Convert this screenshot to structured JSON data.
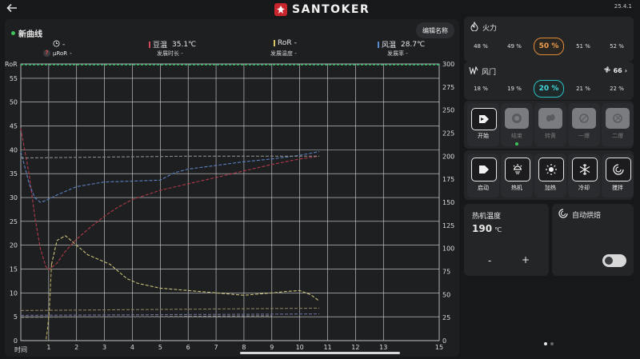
{
  "top_bar": {
    "back_icon": "arrow-left-icon",
    "brand": "SANTOKER",
    "version": "25.4.1"
  },
  "header": {
    "curve_name": "新曲线",
    "rename_button": "编辑名称",
    "time_value": "-",
    "uror_label": "μRoR",
    "uror_value": "-",
    "bean_label": "豆温",
    "bean_value": "35.1℃",
    "bean_sub": "发展时长 -",
    "ror_label": "RoR",
    "ror_value": "-",
    "ror_sub": "发展温度 -",
    "air_label": "风温",
    "air_value": "28.7℃",
    "air_sub": "发展率 -"
  },
  "colors": {
    "accent_orange": "#e08a3c",
    "accent_teal": "#2bc0c4",
    "bean_curve": "#b03a48",
    "air_curve": "#5a7fc0",
    "ror_curve": "#c9c07a",
    "status_green": "#3fc35a"
  },
  "chart_data": {
    "type": "line",
    "xlabel": "时间",
    "ylabel_left": "RoR",
    "x_ticks": [
      "1",
      "2",
      "3",
      "4",
      "5",
      "6",
      "7",
      "8",
      "9",
      "10",
      "11",
      "12",
      "13",
      "15"
    ],
    "y_left_ticks": [
      "0",
      "5",
      "10",
      "15",
      "20",
      "25",
      "30",
      "35",
      "40",
      "45",
      "50",
      "55"
    ],
    "y_right_ticks": [
      "0",
      "25",
      "50",
      "75",
      "100",
      "125",
      "150",
      "175",
      "200",
      "225",
      "250",
      "275",
      "300"
    ],
    "xlim": [
      0,
      15
    ],
    "ylim_left": [
      0,
      58
    ],
    "ylim_right": [
      0,
      300
    ],
    "grid": true,
    "series": [
      {
        "axis": "right",
        "color": "#b03a48",
        "dash": true,
        "x": [
          0,
          0.3,
          0.5,
          0.7,
          0.9,
          1.0,
          1.3,
          1.6,
          2,
          2.5,
          3,
          3.5,
          4,
          5,
          6,
          7,
          8,
          9,
          10,
          10.7
        ],
        "y": [
          230,
          180,
          135,
          100,
          80,
          77,
          84,
          97,
          110,
          123,
          135,
          145,
          153,
          163,
          170,
          177,
          184,
          191,
          197,
          200
        ]
      },
      {
        "axis": "right",
        "color": "#5a7fc0",
        "dash": true,
        "x": [
          0,
          0.3,
          0.5,
          0.7,
          0.9,
          1.3,
          2,
          3,
          4,
          5,
          5.5,
          6,
          7,
          8,
          9,
          10,
          10.7
        ],
        "y": [
          205,
          170,
          155,
          150,
          152,
          158,
          167,
          172,
          173,
          174,
          182,
          186,
          190,
          194,
          197,
          201,
          205
        ]
      },
      {
        "axis": "right",
        "color": "#8a8a8a",
        "dash": true,
        "x": [
          0,
          6,
          10.7
        ],
        "y": [
          198,
          200,
          200
        ]
      },
      {
        "axis": "left",
        "color": "#c9c07a",
        "dash": true,
        "x": [
          1.1,
          1.3,
          1.6,
          2,
          2.4,
          2.8,
          3.2,
          3.8,
          4.2,
          5,
          6,
          7,
          8,
          9,
          9.5,
          10,
          10.4,
          10.7
        ],
        "y": [
          16,
          21,
          22,
          20,
          18,
          17,
          16,
          13,
          12,
          11,
          10.5,
          10,
          9.5,
          10,
          10.3,
          10.5,
          9.6,
          8.3
        ]
      },
      {
        "axis": "left",
        "color": "#b8a860",
        "dash": true,
        "x": [
          1.1,
          1.02,
          0.95,
          0.9
        ],
        "y": [
          16,
          6,
          2,
          0
        ]
      },
      {
        "axis": "left",
        "color": "#8a7f5a",
        "dash": true,
        "x": [
          0,
          10.7
        ],
        "y": [
          6.3,
          6.8
        ]
      },
      {
        "axis": "left",
        "color": "#6a6f9a",
        "dash": true,
        "x": [
          0,
          10.7
        ],
        "y": [
          5.3,
          5.6
        ]
      },
      {
        "axis": "left",
        "color": "#8a8a8a",
        "dash": true,
        "x": [
          0,
          9
        ],
        "y": [
          4.9,
          5.2
        ]
      }
    ]
  },
  "fire_panel": {
    "icon": "flame-icon",
    "label": "火力",
    "options": [
      "48 %",
      "49 %",
      "50 %",
      "51 %",
      "52 %"
    ],
    "selected_index": 2
  },
  "fan_panel": {
    "icon": "wind-icon",
    "label": "风门",
    "extra_value": "66",
    "options": [
      "18 %",
      "19 %",
      "20 %",
      "21 %",
      "22 %"
    ],
    "selected_index": 2
  },
  "phase_buttons": [
    {
      "label": "开始",
      "icon": "play-icon",
      "active": true
    },
    {
      "label": "结束",
      "icon": "stop-icon",
      "active": false
    },
    {
      "label": "转黄",
      "icon": "bean-icon",
      "active": false
    },
    {
      "label": "一爆",
      "icon": "crack-one-icon",
      "active": false
    },
    {
      "label": "二爆",
      "icon": "crack-two-icon",
      "active": false
    }
  ],
  "control_buttons": [
    {
      "label": "启动",
      "icon": "power-play-icon"
    },
    {
      "label": "热机",
      "icon": "preheat-icon"
    },
    {
      "label": "加热",
      "icon": "heat-sun-icon"
    },
    {
      "label": "冷却",
      "icon": "snowflake-icon"
    },
    {
      "label": "搅拌",
      "icon": "stir-icon"
    }
  ],
  "preheat": {
    "label": "热机温度",
    "value": "190",
    "unit": "℃",
    "minus": "-",
    "plus": "+"
  },
  "auto_roast": {
    "icon": "auto-roast-icon",
    "label": "自动烘焙",
    "enabled": false
  },
  "pager": {
    "pages": 2,
    "current": 1
  }
}
